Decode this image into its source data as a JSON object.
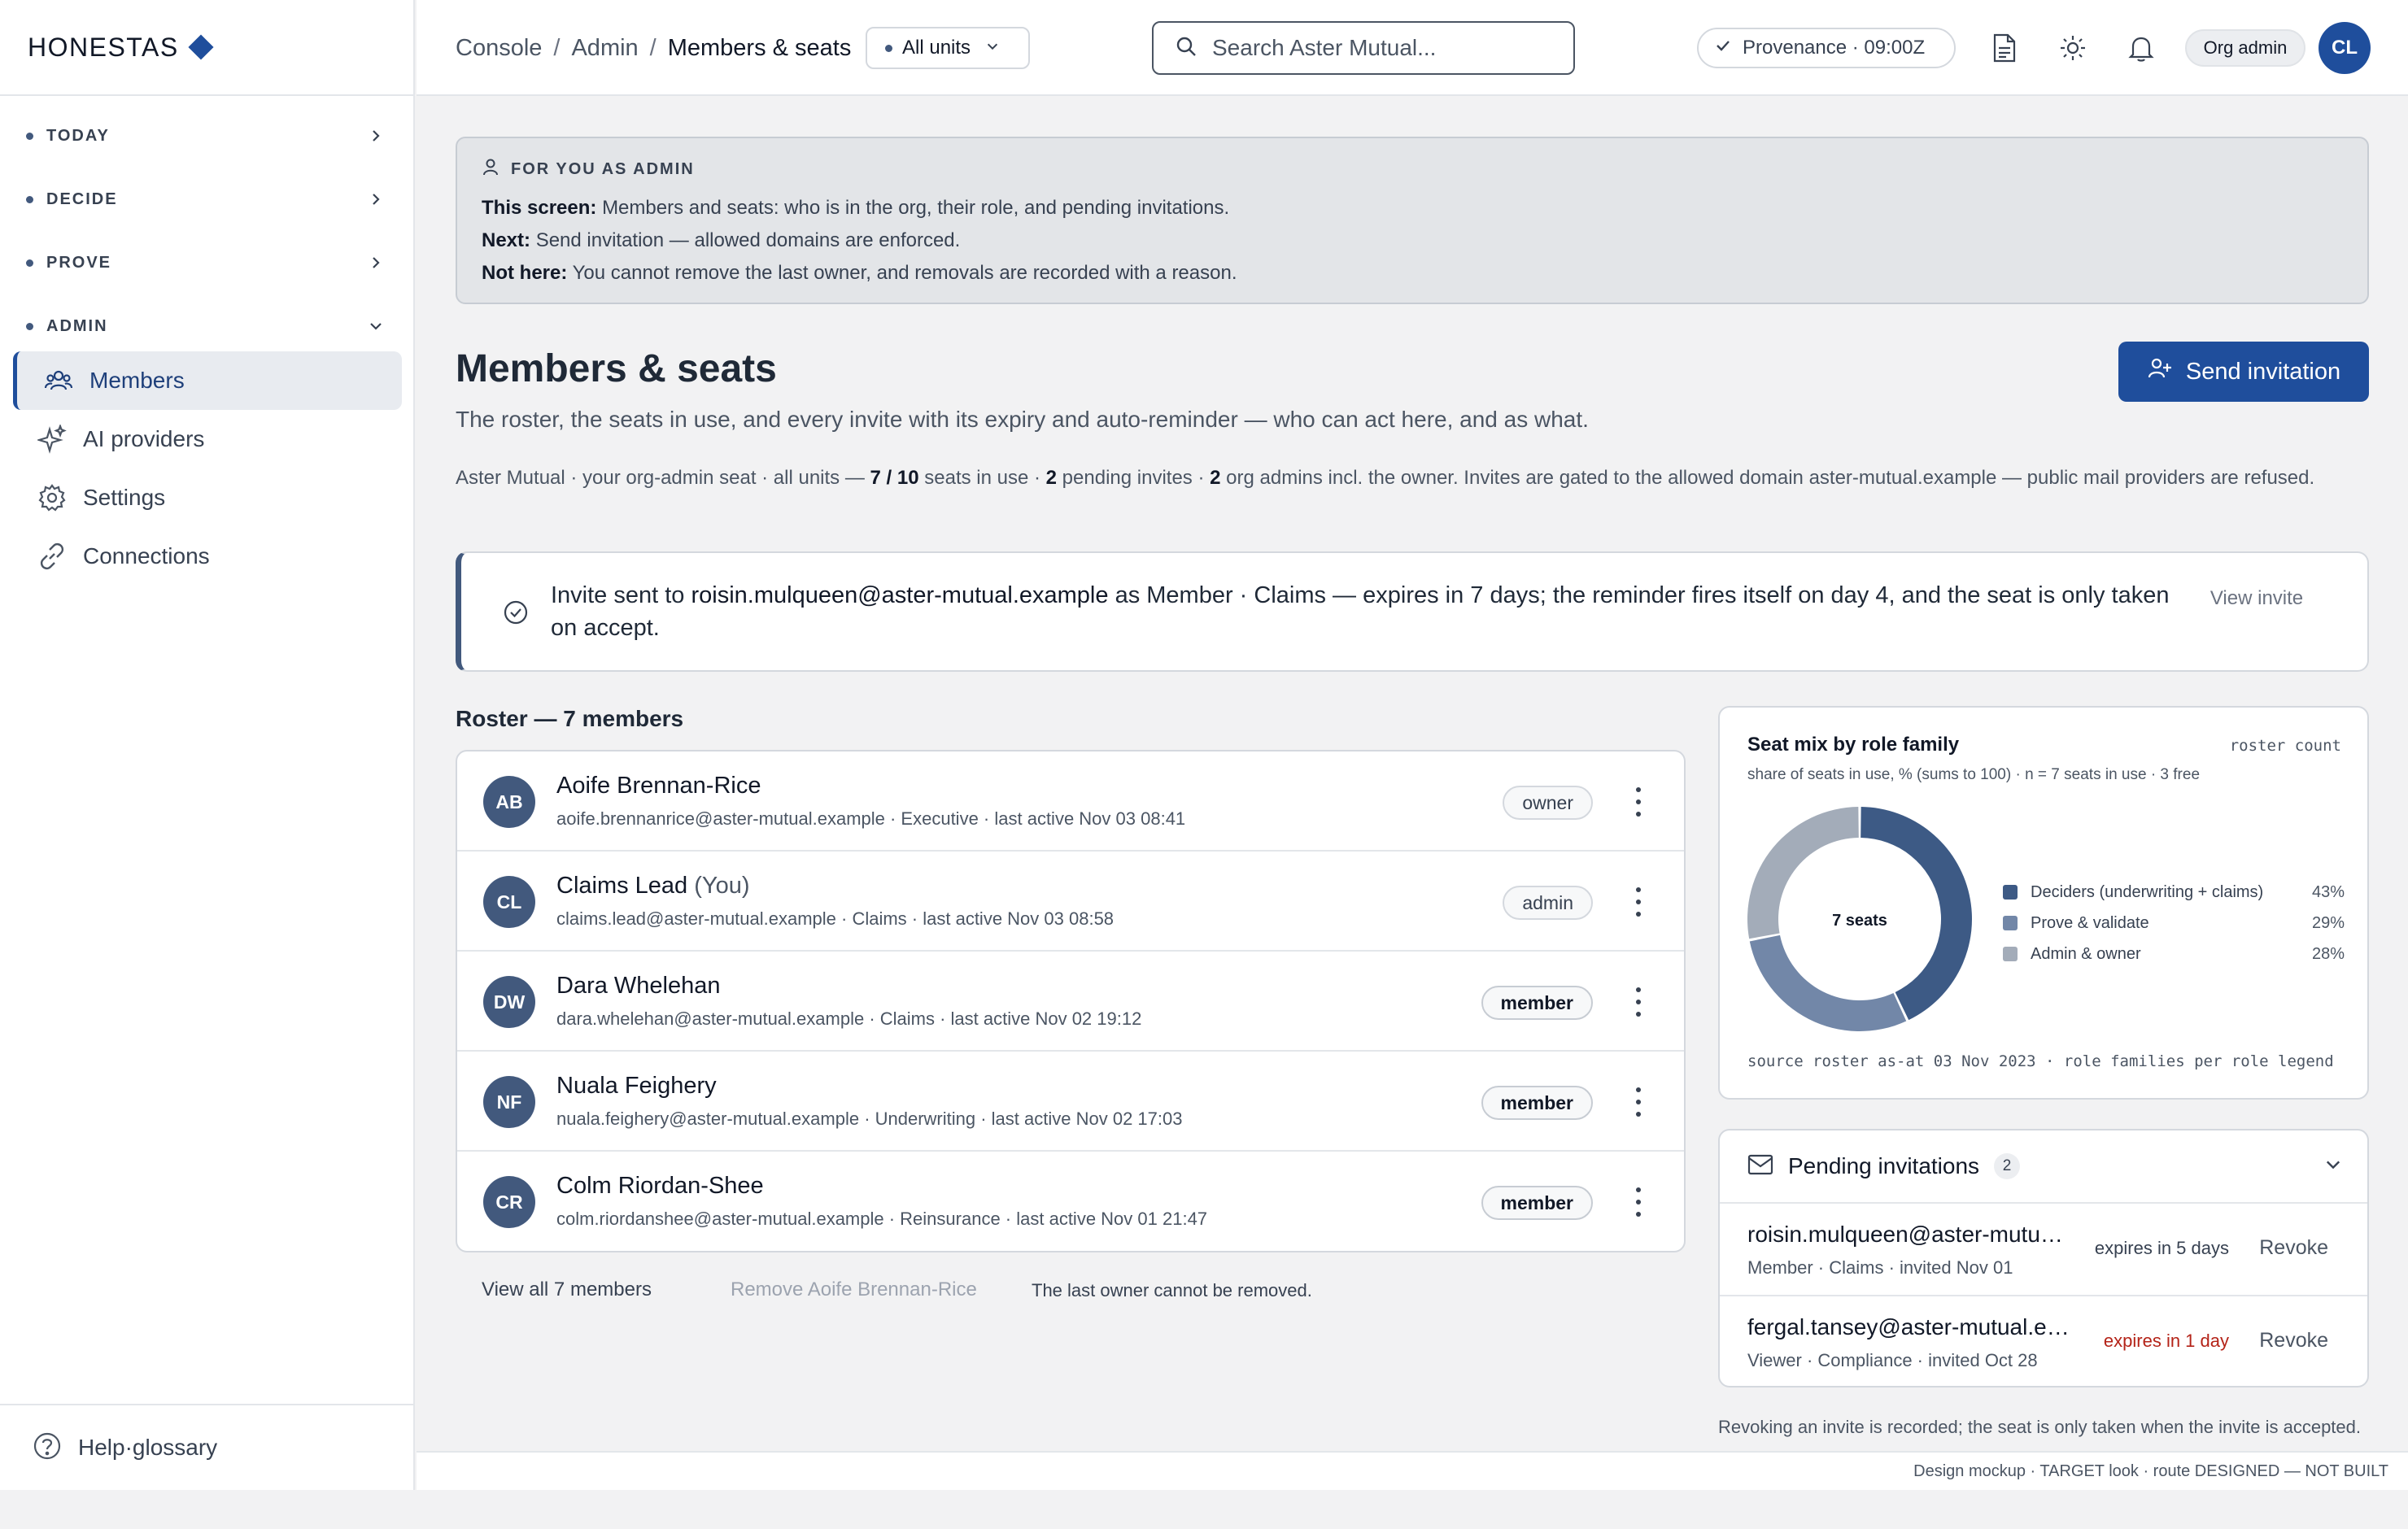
{
  "brand": {
    "name": "HONESTAS"
  },
  "sidebar": {
    "sections": [
      {
        "label": "TODAY"
      },
      {
        "label": "DECIDE"
      },
      {
        "label": "PROVE"
      },
      {
        "label": "ADMIN"
      }
    ],
    "items": [
      {
        "label": "Members",
        "icon": "users-icon"
      },
      {
        "label": "AI providers",
        "icon": "sparkle-icon"
      },
      {
        "label": "Settings",
        "icon": "gear-icon"
      },
      {
        "label": "Connections",
        "icon": "link-icon"
      }
    ],
    "help_label": "Help·glossary"
  },
  "header": {
    "breadcrumbs": [
      "Console",
      "Admin",
      "Members & seats"
    ],
    "unit_select": "All units",
    "search_placeholder": "Search Aster Mutual...",
    "provenance": "Provenance · 09:00Z",
    "role": "Org admin",
    "avatar": "CL"
  },
  "admin_card": {
    "title": "FOR YOU AS ADMIN",
    "screen_label": "This screen:",
    "screen_text": "Members and seats: who is in the org, their role, and pending invitations.",
    "next_label": "Next:",
    "next_text": "Send invitation — allowed domains are enforced.",
    "not_label": "Not here:",
    "not_text": "You cannot remove the last owner, and removals are recorded with a reason."
  },
  "page": {
    "title": "Members & seats",
    "subtitle": "The roster, the seats in use, and every invite with its expiry and auto-reminder — who can act here, and as what.",
    "send_button": "Send invitation",
    "summary": {
      "pre": "Aster Mutual · your org-admin seat · all units — ",
      "seats": "7 / 10",
      "mid1": " seats in use · ",
      "pending": "2",
      "mid2": " pending invites · ",
      "admins": "2",
      "post": " org admins incl. the owner. Invites are gated to the allowed domain aster-mutual.example — public mail providers are refused."
    }
  },
  "toast": {
    "pre": "Invite sent to ",
    "email": "roisin.mulqueen@aster-mutual.example",
    "post": " as Member · Claims — expires in 7 days; the reminder fires itself on day 4, and the seat is only taken on accept.",
    "action": "View invite"
  },
  "roster": {
    "heading": "Roster — 7 members",
    "members": [
      {
        "initials": "AB",
        "name": "Aoife Brennan-Rice",
        "you": "",
        "meta": "aoife.brennanrice@aster-mutual.example · Executive · last active Nov 03 08:41",
        "role": "owner"
      },
      {
        "initials": "CL",
        "name": "Claims Lead",
        "you": "(You)",
        "meta": "claims.lead@aster-mutual.example · Claims · last active Nov 03 08:58",
        "role": "admin"
      },
      {
        "initials": "DW",
        "name": "Dara Whelehan",
        "you": "",
        "meta": "dara.whelehan@aster-mutual.example · Claims · last active Nov 02 19:12",
        "role": "member"
      },
      {
        "initials": "NF",
        "name": "Nuala Feighery",
        "you": "",
        "meta": "nuala.feighery@aster-mutual.example · Underwriting · last active Nov 02 17:03",
        "role": "member"
      },
      {
        "initials": "CR",
        "name": "Colm Riordan-Shee",
        "you": "",
        "meta": "colm.riordanshee@aster-mutual.example · Reinsurance · last active Nov 01 21:47",
        "role": "member"
      }
    ],
    "view_all": "View all 7 members",
    "remove_owner": "Remove Aoife Brennan-Rice",
    "owner_note": "The last owner cannot be removed."
  },
  "chart_card": {
    "tag": "roster count",
    "subtitle": "share of seats in use, % (sums to 100) · n = 7 seats in use · 3 free",
    "source": "source roster as-at 03 Nov 2023 · role families per role legend"
  },
  "chart_data": {
    "type": "pie",
    "title": "Seat mix by role family",
    "center_label": "7 seats",
    "slices": [
      {
        "label": "Deciders (underwriting + claims)",
        "value": 43,
        "display": "43%",
        "color": "#3d5a85"
      },
      {
        "label": "Prove & validate",
        "value": 29,
        "display": "29%",
        "color": "#7287a8"
      },
      {
        "label": "Admin & owner",
        "value": 28,
        "display": "28%",
        "color": "#a3acb9"
      }
    ]
  },
  "invitations": {
    "title": "Pending invitations",
    "count": "2",
    "items": [
      {
        "email": "roisin.mulqueen@aster-mutual.example",
        "meta": "Member · Claims · invited Nov 01",
        "expiry": "expires in 5 days",
        "revoke": "Revoke"
      },
      {
        "email": "fergal.tansey@aster-mutual.example",
        "meta": "Viewer · Compliance · invited Oct 28",
        "expiry": "expires in 1 day",
        "revoke": "Revoke"
      }
    ],
    "note": "Revoking an invite is recorded; the seat is only taken when the invite is accepted."
  },
  "footer": {
    "text": "Design mockup · TARGET look · route DESIGNED — NOT BUILT"
  },
  "colors": {
    "accent": "#1f4e9c",
    "slate": "#42597d",
    "warn": "#b42318"
  }
}
